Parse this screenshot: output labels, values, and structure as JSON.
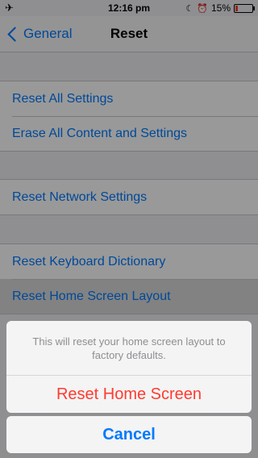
{
  "status_bar": {
    "time": "12:16 pm",
    "battery_percent": "15%",
    "battery_level": 0.15,
    "icons": [
      "airplane-icon",
      "moon-icon",
      "alarm-icon",
      "battery-icon"
    ],
    "battery_color": "#ff3b30"
  },
  "nav": {
    "back_label": "General",
    "title": "Reset"
  },
  "groups": [
    {
      "items": [
        "Reset All Settings",
        "Erase All Content and Settings"
      ]
    },
    {
      "items": [
        "Reset Network Settings"
      ]
    },
    {
      "items": [
        "Reset Keyboard Dictionary",
        "Reset Home Screen Layout"
      ]
    }
  ],
  "action_sheet": {
    "message": "This will reset your home screen layout to factory defaults.",
    "destructive_label": "Reset Home Screen",
    "cancel_label": "Cancel"
  },
  "colors": {
    "accent": "#007aff",
    "destructive": "#ff3b30"
  }
}
